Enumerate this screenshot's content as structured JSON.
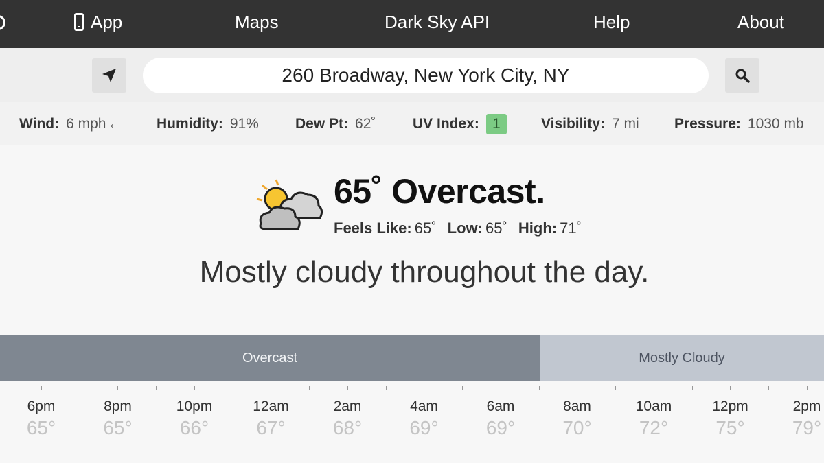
{
  "nav": {
    "app": "App",
    "maps": "Maps",
    "api": "Dark Sky API",
    "help": "Help",
    "about": "About"
  },
  "search": {
    "value": "260 Broadway, New York City, NY"
  },
  "conditions": {
    "wind_label": "Wind:",
    "wind_value": "6 mph",
    "wind_arrow": "←",
    "humidity_label": "Humidity:",
    "humidity_value": "91%",
    "dew_label": "Dew Pt:",
    "dew_value": "62˚",
    "uv_label": "UV Index:",
    "uv_value": "1",
    "visibility_label": "Visibility:",
    "visibility_value": "7 mi",
    "pressure_label": "Pressure:",
    "pressure_value": "1030 mb"
  },
  "current": {
    "headline": "65˚ Overcast.",
    "feels_label": "Feels Like:",
    "feels_value": "65˚",
    "low_label": "Low:",
    "low_value": "65˚",
    "high_label": "High:",
    "high_value": "71˚",
    "icon": "partly-cloudy-day-icon",
    "summary": "Mostly cloudy throughout the day."
  },
  "timeline": {
    "segments": [
      {
        "label": "Overcast",
        "color": "#7f8791"
      },
      {
        "label": "Mostly Cloudy",
        "color": "#c1c7d0"
      }
    ],
    "hours": [
      {
        "time": "6pm",
        "temp": "65°"
      },
      {
        "time": "8pm",
        "temp": "65°"
      },
      {
        "time": "10pm",
        "temp": "66°"
      },
      {
        "time": "12am",
        "temp": "67°"
      },
      {
        "time": "2am",
        "temp": "68°"
      },
      {
        "time": "4am",
        "temp": "69°"
      },
      {
        "time": "6am",
        "temp": "69°"
      },
      {
        "time": "8am",
        "temp": "70°"
      },
      {
        "time": "10am",
        "temp": "72°"
      },
      {
        "time": "12pm",
        "temp": "75°"
      },
      {
        "time": "2pm",
        "temp": "79°"
      }
    ]
  },
  "colors": {
    "nav_bg": "#333333",
    "uv_badge": "#7ccb84",
    "overcast": "#7f8791",
    "mostly_cloudy": "#c1c7d0"
  }
}
